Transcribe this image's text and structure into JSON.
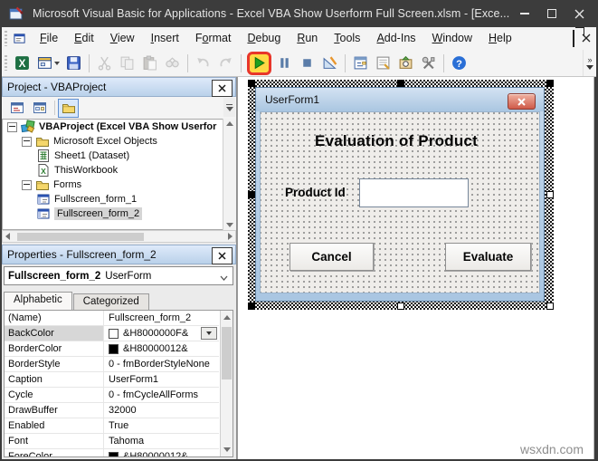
{
  "window": {
    "title": "Microsoft Visual Basic for Applications - Excel VBA Show Userform Full Screen.xlsm - [Exce..."
  },
  "menubar": {
    "items": [
      {
        "label": "File",
        "accel": 0
      },
      {
        "label": "Edit",
        "accel": 0
      },
      {
        "label": "View",
        "accel": 0
      },
      {
        "label": "Insert",
        "accel": 0
      },
      {
        "label": "Format",
        "accel": 1
      },
      {
        "label": "Debug",
        "accel": 0
      },
      {
        "label": "Run",
        "accel": 0
      },
      {
        "label": "Tools",
        "accel": 0
      },
      {
        "label": "Add-Ins",
        "accel": 0
      },
      {
        "label": "Window",
        "accel": 0
      },
      {
        "label": "Help",
        "accel": 0
      }
    ]
  },
  "toolbar": {
    "highlight_color": "#e8362a",
    "buttons": [
      {
        "name": "view-microsoft-excel",
        "icon": "excel"
      },
      {
        "name": "insert-userform",
        "icon": "userform",
        "dropdown": true
      },
      {
        "name": "save",
        "icon": "save"
      },
      {
        "sep": true
      },
      {
        "name": "cut",
        "icon": "cut",
        "disabled": true
      },
      {
        "name": "copy",
        "icon": "copy",
        "disabled": true
      },
      {
        "name": "paste",
        "icon": "paste",
        "disabled": true
      },
      {
        "name": "find",
        "icon": "find",
        "disabled": true
      },
      {
        "sep": true
      },
      {
        "name": "undo",
        "icon": "undo",
        "disabled": true
      },
      {
        "name": "redo",
        "icon": "redo",
        "disabled": true
      },
      {
        "sep": true
      },
      {
        "name": "run-sub-userform",
        "icon": "run",
        "highlighted": true
      },
      {
        "name": "break",
        "icon": "break"
      },
      {
        "name": "reset",
        "icon": "reset"
      },
      {
        "name": "design-mode",
        "icon": "design"
      },
      {
        "sep": true
      },
      {
        "name": "project-explorer",
        "icon": "projexp"
      },
      {
        "name": "properties-window",
        "icon": "propswin"
      },
      {
        "name": "object-browser",
        "icon": "objbrowser"
      },
      {
        "name": "toolbox",
        "icon": "toolbox"
      },
      {
        "sep": true
      },
      {
        "name": "help",
        "icon": "help"
      }
    ]
  },
  "project_panel": {
    "title": "Project - VBAProject",
    "tools": [
      {
        "name": "view-code",
        "icon": "viewcode"
      },
      {
        "name": "view-object",
        "icon": "viewobject"
      },
      {
        "name": "toggle-folders",
        "icon": "folder",
        "active": true
      }
    ],
    "tree": [
      {
        "label": "VBAProject (Excel VBA Show Userfor",
        "icon": "project",
        "level": 0,
        "bold": true,
        "expander": true
      },
      {
        "label": "Microsoft Excel Objects",
        "icon": "folder",
        "level": 1,
        "expander": true
      },
      {
        "label": "Sheet1 (Dataset)",
        "icon": "sheet",
        "level": 2
      },
      {
        "label": "ThisWorkbook",
        "icon": "workbook",
        "level": 2
      },
      {
        "label": "Forms",
        "icon": "folder",
        "level": 1,
        "expander": true
      },
      {
        "label": "Fullscreen_form_1",
        "icon": "form",
        "level": 2
      },
      {
        "label": "Fullscreen_form_2",
        "icon": "form",
        "level": 2,
        "selected": true
      }
    ]
  },
  "properties_panel": {
    "title": "Properties - Fullscreen_form_2",
    "selected_object": {
      "name": "Fullscreen_form_2",
      "type": "UserForm"
    },
    "tabs": [
      {
        "label": "Alphabetic",
        "active": true
      },
      {
        "label": "Categorized",
        "active": false
      }
    ],
    "rows": [
      {
        "name": "(Name)",
        "value": "Fullscreen_form_2"
      },
      {
        "name": "BackColor",
        "value": "&H8000000F&",
        "swatch": "#ffffff",
        "dropdown": true,
        "selected": true
      },
      {
        "name": "BorderColor",
        "value": "&H80000012&",
        "swatch": "#000000"
      },
      {
        "name": "BorderStyle",
        "value": "0 - fmBorderStyleNone"
      },
      {
        "name": "Caption",
        "value": "UserForm1"
      },
      {
        "name": "Cycle",
        "value": "0 - fmCycleAllForms"
      },
      {
        "name": "DrawBuffer",
        "value": "32000"
      },
      {
        "name": "Enabled",
        "value": "True"
      },
      {
        "name": "Font",
        "value": "Tahoma"
      },
      {
        "name": "ForeColor",
        "value": "&H80000012&",
        "swatch": "#000000"
      }
    ]
  },
  "designer": {
    "form": {
      "title": "UserForm1",
      "heading": "Evaluation of Product",
      "product_label": "Product Id",
      "input_value": "",
      "cancel_label": "Cancel",
      "evaluate_label": "Evaluate"
    }
  },
  "watermark": "wsxdn.com"
}
